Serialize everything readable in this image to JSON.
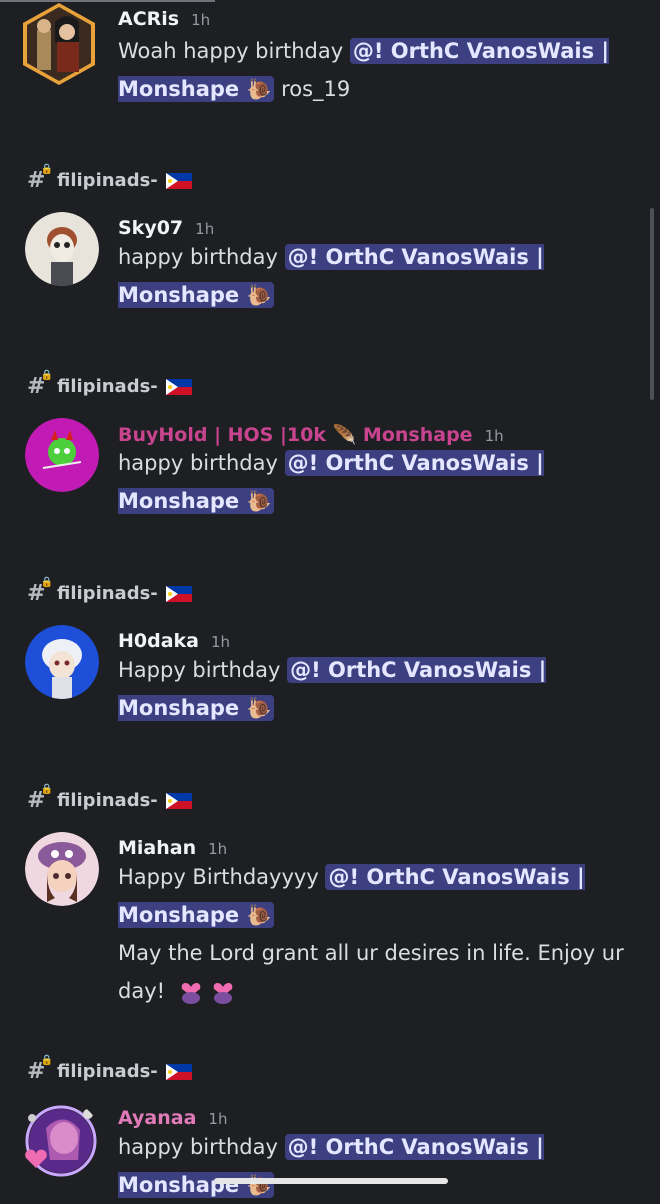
{
  "mention_text": "@! OrthC VanosWais |",
  "mention_text2": "Monshape",
  "channel_name": "filipinads-",
  "messages": [
    {
      "author": "ACRis",
      "time": "1h",
      "prefix": "Woah happy birthday",
      "suffix": "ros_19"
    },
    {
      "author": "Sky07",
      "time": "1h",
      "prefix": "happy birthday"
    },
    {
      "author": "BuyHold | HOS |10k",
      "author_suffix": "Monshape",
      "time": "1h",
      "prefix": "happy birthday",
      "author_color": "#c8448f"
    },
    {
      "author": "H0daka",
      "time": "1h",
      "prefix": "Happy birthday"
    },
    {
      "author": "Miahan",
      "time": "1h",
      "prefix": "Happy Birthdayyyy",
      "extra": "May the Lord grant all ur desires in life. Enjoy ur day!"
    },
    {
      "author": "Ayanaa",
      "time": "1h",
      "prefix": "happy birthday",
      "author_color": "#e07ab8"
    }
  ],
  "colors": {
    "background": "#1e1f22",
    "mention_bg": "#3c4081",
    "mention_fg": "#e4e7ff"
  }
}
